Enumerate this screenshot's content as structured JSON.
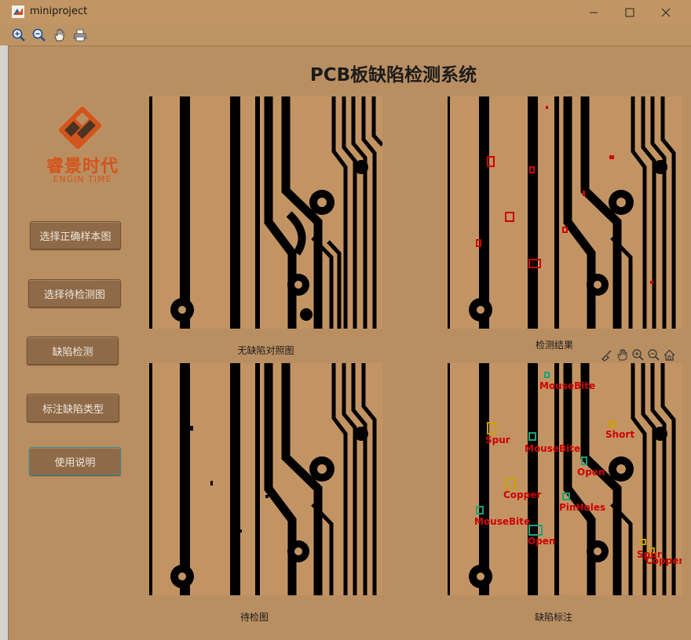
{
  "window": {
    "title": "miniproject",
    "controls": {
      "minimize": "—",
      "maximize": "☐",
      "close": "✕"
    }
  },
  "toolbar": {
    "tools": [
      "zoom-in",
      "zoom-out",
      "pan",
      "print"
    ]
  },
  "app": {
    "title": "PCB板缺陷检测系统"
  },
  "logo": {
    "name_cn": "睿景时代",
    "name_en": "ENGIN TIME",
    "color": "#d4541b"
  },
  "sidebar": {
    "buttons": [
      {
        "label": "选择正确样本图"
      },
      {
        "label": "选择待检测图"
      },
      {
        "label": "缺陷检测"
      },
      {
        "label": "标注缺陷类型"
      },
      {
        "label": "使用说明"
      }
    ]
  },
  "panels": {
    "reference": {
      "caption": "无缺陷对照图"
    },
    "result": {
      "caption": "检测结果"
    },
    "test": {
      "caption": "待检图"
    },
    "annotated": {
      "caption": "缺陷标注"
    }
  },
  "annotations": [
    {
      "label": "MouseBite"
    },
    {
      "label": "Spur"
    },
    {
      "label": "MouseBite"
    },
    {
      "label": "Short"
    },
    {
      "label": "Open"
    },
    {
      "label": "Copper"
    },
    {
      "label": "PinHoles"
    },
    {
      "label": "MouseBite"
    },
    {
      "label": "Open"
    },
    {
      "label": "Spur"
    },
    {
      "label": "Copper"
    }
  ],
  "colors": {
    "background": "#b98f62",
    "board": "#c39463",
    "trace": "#000000",
    "defect_box": "#d00000",
    "label": "#d00000"
  }
}
